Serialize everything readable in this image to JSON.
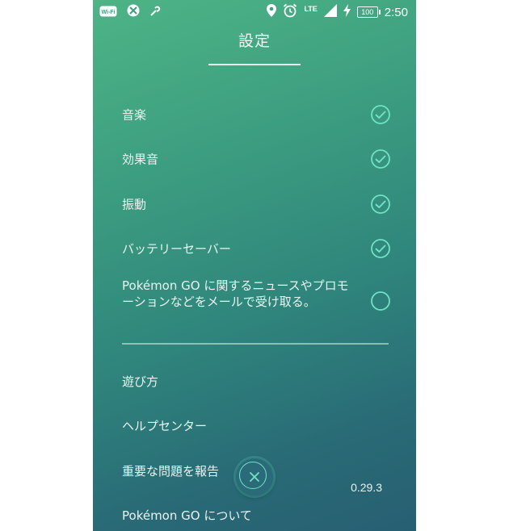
{
  "status_bar": {
    "icons": [
      "wifi-icon",
      "no-sim-icon",
      "wrench-icon",
      "location-icon",
      "alarm-icon",
      "signal-icon",
      "charging-icon",
      "battery-icon"
    ],
    "network_label": "LTE",
    "battery_level": "100",
    "time": "2:50"
  },
  "header": {
    "title": "設定"
  },
  "settings": {
    "music": {
      "label": "音楽",
      "checked": true
    },
    "sound_effects": {
      "label": "効果音",
      "checked": true
    },
    "vibration": {
      "label": "振動",
      "checked": true
    },
    "battery_saver": {
      "label": "バッテリーセーバー",
      "checked": true
    },
    "news_opt_in": {
      "label": "Pokémon GO に関するニュースやプロモーションなどをメールで受け取る。",
      "checked": false
    }
  },
  "menu": {
    "how_to_play": "遊び方",
    "help_center": "ヘルプセンター",
    "report_issue": "重要な問題を報告",
    "about": "Pokémon GO について"
  },
  "version": "0.29.3",
  "colors": {
    "accent": "#6fe3c4",
    "bg_top": "#4eb486",
    "bg_bottom": "#275f72"
  }
}
